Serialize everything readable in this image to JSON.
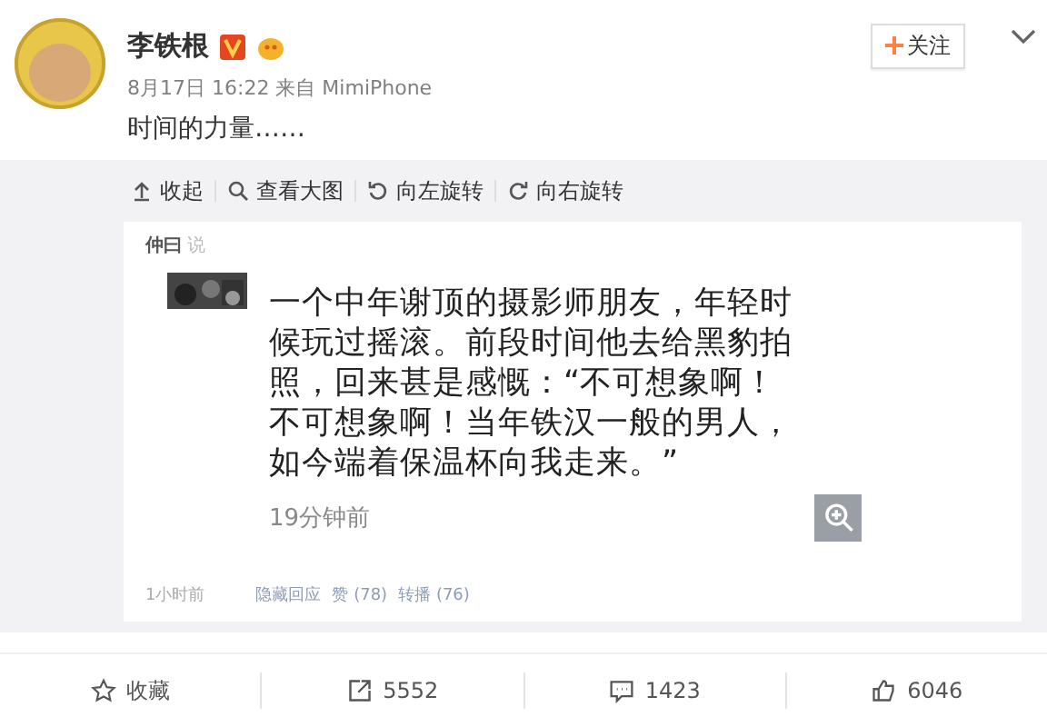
{
  "post": {
    "author": "李铁根",
    "verified": true,
    "date": "8月17日 16:22",
    "source_prefix": "来自",
    "source": "MimiPhone",
    "text": "时间的力量……",
    "follow_button": "关注"
  },
  "image_toolbar": [
    {
      "kind": "collapse",
      "label": "收起"
    },
    {
      "kind": "zoom",
      "label": "查看大图"
    },
    {
      "kind": "rotate-left",
      "label": "向左旋转"
    },
    {
      "kind": "rotate-right",
      "label": "向右旋转"
    }
  ],
  "embedded_post": {
    "author": "仲曰",
    "says": "说",
    "text": "一个中年谢顶的摄影师朋友，年轻时候玩过摇滚。前段时间他去给黑豹拍照，回来甚是感慨：“不可想象啊！不可想象啊！当年铁汉一般的男人，如今端着保温杯向我走来。”",
    "time": "19分钟前",
    "footer_time": "1小时前",
    "actions": [
      "隐藏回应",
      "赞 (78)",
      "转播 (76)"
    ]
  },
  "action_bar": [
    {
      "kind": "favorite",
      "label": "收藏"
    },
    {
      "kind": "repost",
      "label": "5552"
    },
    {
      "kind": "comment",
      "label": "1423"
    },
    {
      "kind": "like",
      "label": "6046"
    }
  ]
}
